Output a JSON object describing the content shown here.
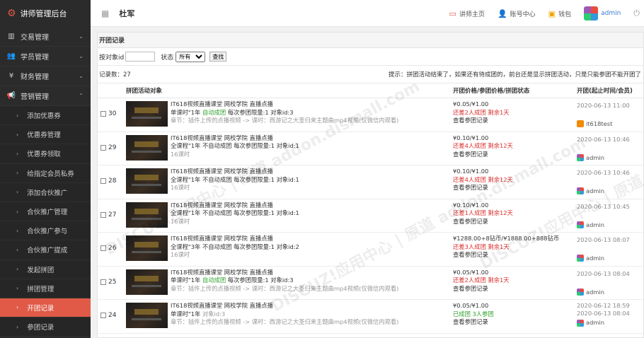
{
  "brand": {
    "title": "讲师管理后台"
  },
  "sidebar": {
    "groups": [
      {
        "label": "交易管理",
        "icon": "bar-chart-icon"
      },
      {
        "label": "学员管理",
        "icon": "users-icon"
      },
      {
        "label": "财务管理",
        "icon": "yen-icon"
      },
      {
        "label": "营销管理",
        "icon": "megaphone-icon"
      }
    ],
    "items": [
      {
        "label": "添加优惠券"
      },
      {
        "label": "优惠券管理"
      },
      {
        "label": "优惠券领取"
      },
      {
        "label": "给指定会员私券"
      },
      {
        "label": "添加合伙推广"
      },
      {
        "label": "合伙推广管理"
      },
      {
        "label": "合伙推广参与"
      },
      {
        "label": "合伙推广提成"
      },
      {
        "label": "发起拼团"
      },
      {
        "label": "拼团管理"
      },
      {
        "label": "开团记录"
      },
      {
        "label": "参团记录"
      }
    ]
  },
  "topbar": {
    "username": "杜军",
    "links": [
      "讲师主页",
      "账号中心",
      "钱包",
      "admin"
    ]
  },
  "panel": {
    "title": "开团记录",
    "filter": {
      "id_label": "按对象id",
      "status_label": "状态",
      "status_value": "所有",
      "search_label": "查找"
    },
    "total": "记录数：27",
    "tip": "提示：拼团活动结束了，如果还有待成团的，前台还是显示拼团活动，只是只能参团不能开团了",
    "columns": [
      "拼团活动对象",
      "开团价格/参团价格/拼团状态",
      "开团(起止时间/会员)"
    ]
  },
  "rows": [
    {
      "id": "30",
      "title": "IT618视频直播课堂 网校学院 直播点播",
      "line2a": "单课时\"1年",
      "line2b": "自动成团",
      "line2c": "每次参团限量:1",
      "line2d": "对象id:3",
      "line3": "章节：插件上传的点播视频 -> 课时：西游记之大圣归来主题曲mp4视频(仅微信内观看)",
      "price": "¥0.05/¥1.00",
      "status": "还差2人成团 剩余1天",
      "status_color": "red",
      "link": "查看参团记录",
      "time": "2020-06-13 11:00",
      "user": "it618test"
    },
    {
      "id": "29",
      "title": "IT618视频直播课堂 网校学院 直播点播",
      "line2a": "全课程\"1年",
      "line2b": "不自动成团",
      "line2c": "每次参团限量:1",
      "line2d": "对象id:1",
      "line3": "16课时",
      "price": "¥0.10/¥1.00",
      "status": "还差4人成团 剩余12天",
      "status_color": "red",
      "link": "查看参团记录",
      "time": "2020-06-13 10:46",
      "user": "admin"
    },
    {
      "id": "28",
      "title": "IT618视频直播课堂 网校学院 直播点播",
      "line2a": "全课程\"1年",
      "line2b": "不自动成团",
      "line2c": "每次参团限量:1",
      "line2d": "对象id:1",
      "line3": "16课时",
      "price": "¥0.10/¥1.00",
      "status": "还差4人成团 剩余12天",
      "status_color": "red",
      "link": "查看参团记录",
      "time": "2020-06-13 10:46",
      "user": "admin"
    },
    {
      "id": "27",
      "title": "IT618视频直播课堂 网校学院 直播点播",
      "line2a": "全课程\"1年",
      "line2b": "不自动成团",
      "line2c": "每次参团限量:1",
      "line2d": "对象id:1",
      "line3": "16课时",
      "price": "¥0.10/¥1.00",
      "status": "还差1人成团 剩余12天",
      "status_color": "red",
      "link": "查看参团记录",
      "time": "2020-06-13 10:45",
      "user": "admin"
    },
    {
      "id": "26",
      "title": "IT618视频直播课堂 网校学院 直播点播",
      "line2a": "全课程\"3年",
      "line2b": "不自动成团",
      "line2c": "每次参团限量:1",
      "line2d": "对象id:2",
      "line3": "16课时",
      "price": "¥1288.00+8钻币/¥1888.00+888钻币",
      "status": "还差3人成团 剩余1天",
      "status_color": "red",
      "link": "查看参团记录",
      "time": "2020-06-13 08:07",
      "user": "admin"
    },
    {
      "id": "25",
      "title": "IT618视频直播课堂 网校学院 直播点播",
      "line2a": "单课时\"1年",
      "line2b": "自动成团",
      "line2c": "每次参团限量:1",
      "line2d": "对象id:3",
      "line3": "章节：插件上传的点播视频 -> 课时：西游记之大圣归来主题曲mp4视频(仅微信内观看)",
      "price": "¥0.05/¥1.00",
      "status": "还差2人成团 剩余1天",
      "status_color": "red",
      "link": "查看参团记录",
      "time": "2020-06-13 08:04",
      "user": "admin"
    },
    {
      "id": "24",
      "title": "IT618视频直播课堂 网校学院 直播点播",
      "line2a": "单课时\"1年",
      "line2b": "",
      "line2c": "",
      "line2d": "对象id:3",
      "line3": "章节：插件上传的点播视频 -> 课时：西游记之大圣归来主题曲mp4视频(仅微信内观看)",
      "price": "¥0.05/¥1.00",
      "status": "已成团 3人参团",
      "status_color": "green",
      "link": "查看参团记录",
      "time": "2020-06-12 18:59",
      "time2": "2020-06-13 08:04",
      "user": "admin"
    }
  ],
  "watermark": "DISCUZ!应用中心 | 原道 addon.dismall.com"
}
